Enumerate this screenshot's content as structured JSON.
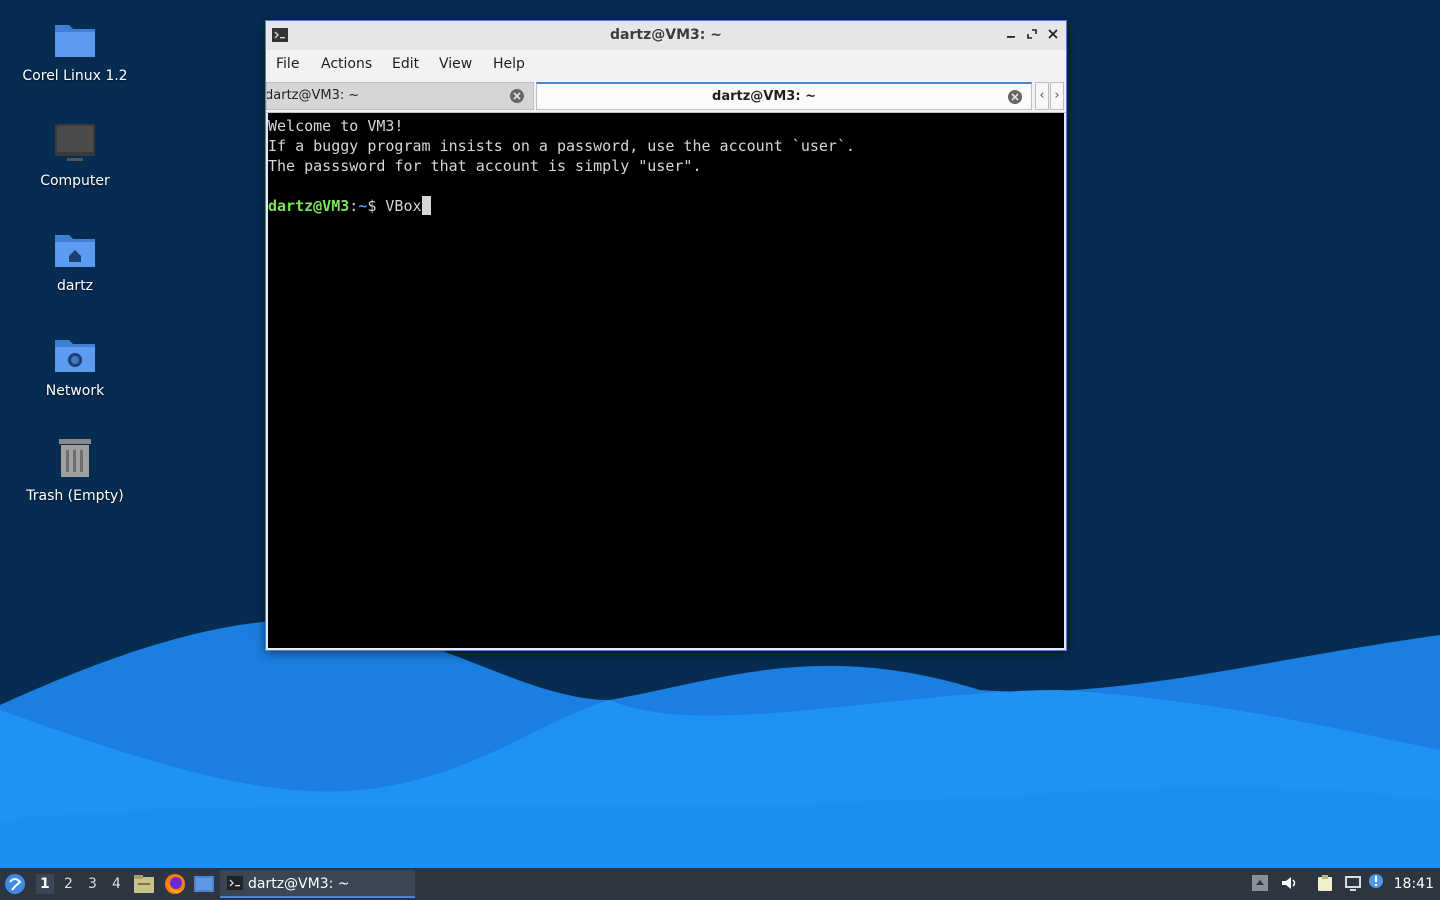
{
  "desktop": {
    "icons": [
      {
        "label": "Corel Linux 1.2",
        "icon": "folder-icon"
      },
      {
        "label": "Computer",
        "icon": "computer-icon"
      },
      {
        "label": "dartz",
        "icon": "home-folder-icon"
      },
      {
        "label": "Network",
        "icon": "network-folder-icon"
      },
      {
        "label": "Trash (Empty)",
        "icon": "trash-icon"
      }
    ]
  },
  "window": {
    "title": "dartz@VM3: ~",
    "menu": [
      "File",
      "Actions",
      "Edit",
      "View",
      "Help"
    ],
    "tabs": [
      {
        "label": "dartz@VM3: ~",
        "active": false
      },
      {
        "label": "dartz@VM3: ~",
        "active": true
      }
    ],
    "tab_scroll_left": "‹",
    "tab_scroll_right": "›"
  },
  "terminal": {
    "lines": [
      "Welcome to VM3!",
      "If a buggy program insists on a password, use the account `user`.",
      "The passsword for that account is simply \"user\"."
    ],
    "prompt_user": "dartz@VM3",
    "prompt_sep": ":",
    "prompt_path": "~",
    "prompt_symbol": "$ ",
    "input": "VBox"
  },
  "taskbar": {
    "workspaces": [
      "1",
      "2",
      "3",
      "4"
    ],
    "active_workspace": "1",
    "task_label": "dartz@VM3: ~",
    "clock": "18:41"
  },
  "colors": {
    "accent": "#4d84d1",
    "prompt_user": "#7ee25a",
    "prompt_path": "#5a8ef0",
    "desktop_bg": "#062c52",
    "wave": "#1e8ef0"
  }
}
